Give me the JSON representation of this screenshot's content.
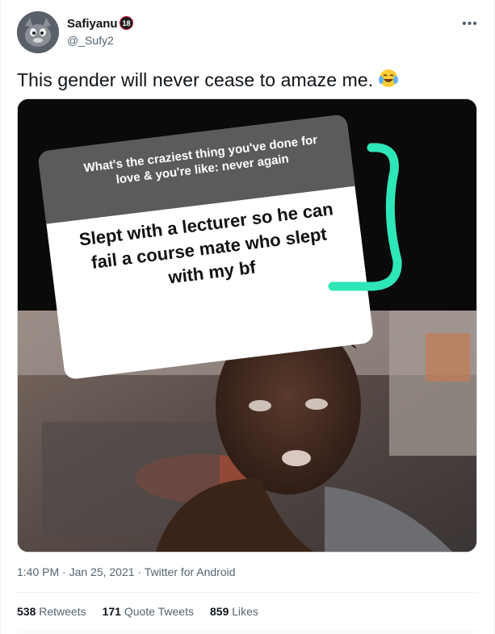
{
  "author": {
    "name": "Safiyanu",
    "badge": "18",
    "handle": "@_Sufy2"
  },
  "tweet": {
    "text": "This gender will never cease to amaze me.",
    "emoji_icon": "tears-of-joy-emoji"
  },
  "media": {
    "question": {
      "line1": "What's the craziest thing you've done for",
      "line2": "love & you're like: never again"
    },
    "answer": {
      "line1": "Slept with a lecturer so he can",
      "line2": "fail a course mate who slept",
      "line3": "with my bf"
    },
    "highlight_color": "#2ee6b8"
  },
  "meta": {
    "timestamp": "1:40 PM · Jan 25, 2021 · Twitter for Android"
  },
  "stats": {
    "retweets_count": "538",
    "retweets_label": "Retweets",
    "quotes_count": "171",
    "quotes_label": "Quote Tweets",
    "likes_count": "859",
    "likes_label": "Likes"
  }
}
